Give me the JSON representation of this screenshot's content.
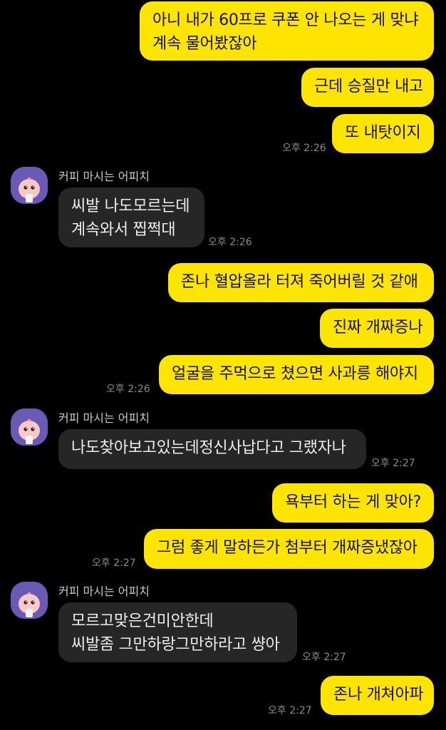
{
  "chat": {
    "colors": {
      "background": "#000000",
      "my_bubble": "#FEE500",
      "their_bubble": "#262626",
      "avatar_bg": "#6B59B6"
    },
    "sender_name": "커피 마시는 어피치",
    "messages": [
      {
        "from": "me",
        "text": "아니 내가 60프로 쿠폰 안 나오는 게 맞냐\n계속 물어봤잖아"
      },
      {
        "from": "me",
        "text": "근데 승질만 내고"
      },
      {
        "from": "me",
        "text": "또 내탓이지",
        "time": "오후 2:26"
      },
      {
        "from": "them",
        "sender": "커피 마시는 어피치",
        "text": "씨발 나도모르는데\n계속와서 찝쩍대",
        "time": "오후 2:26"
      },
      {
        "from": "me",
        "text": "존나 혈압올라 터져 죽어버릴 것 같애"
      },
      {
        "from": "me",
        "text": "진짜 개짜증나"
      },
      {
        "from": "me",
        "text": "얼굴을 주먹으로 쳤으면 사과릉 해야지",
        "time": "오후 2:26"
      },
      {
        "from": "them",
        "sender": "커피 마시는 어피치",
        "text": "나도찾아보고있는데정신사납다고 그랬자나",
        "time": "오후 2:27"
      },
      {
        "from": "me",
        "text": "욕부터 하는 게 맞아?"
      },
      {
        "from": "me",
        "text": "그럼 좋게 말하든가 첨부터 개짜증냈잖아",
        "time": "오후 2:27"
      },
      {
        "from": "them",
        "sender": "커피 마시는 어피치",
        "text": "모르고맞은건미안한데\n씨발좀 그만하랑그만하라고 썅아",
        "time": "오후 2:27"
      },
      {
        "from": "me",
        "text": "존나 개쳐아파",
        "time": "오후 2:27"
      }
    ]
  }
}
